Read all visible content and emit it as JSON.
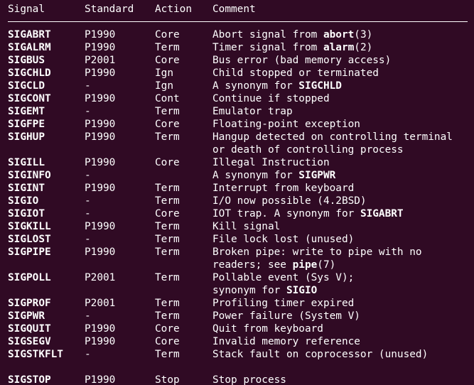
{
  "colors": {
    "background": "#300a24",
    "text": "#ffffff"
  },
  "header": {
    "signal": "Signal",
    "standard": "Standard",
    "action": "Action",
    "comment": "Comment"
  },
  "rows": [
    {
      "signal": "SIGABRT",
      "standard": "P1990",
      "action": "Core",
      "comment": [
        [
          "Abort signal from ",
          false
        ],
        [
          "abort",
          true
        ],
        [
          "(3)",
          false
        ]
      ]
    },
    {
      "signal": "SIGALRM",
      "standard": "P1990",
      "action": "Term",
      "comment": [
        [
          "Timer signal from ",
          false
        ],
        [
          "alarm",
          true
        ],
        [
          "(2)",
          false
        ]
      ]
    },
    {
      "signal": "SIGBUS",
      "standard": "P2001",
      "action": "Core",
      "comment": [
        [
          "Bus error (bad memory access)",
          false
        ]
      ]
    },
    {
      "signal": "SIGCHLD",
      "standard": "P1990",
      "action": "Ign",
      "comment": [
        [
          "Child stopped or terminated",
          false
        ]
      ]
    },
    {
      "signal": "SIGCLD",
      "standard": "-",
      "action": "Ign",
      "comment": [
        [
          "A synonym for ",
          false
        ],
        [
          "SIGCHLD",
          true
        ]
      ]
    },
    {
      "signal": "SIGCONT",
      "standard": "P1990",
      "action": "Cont",
      "comment": [
        [
          "Continue if stopped",
          false
        ]
      ]
    },
    {
      "signal": "SIGEMT",
      "standard": "-",
      "action": "Term",
      "comment": [
        [
          "Emulator trap",
          false
        ]
      ]
    },
    {
      "signal": "SIGFPE",
      "standard": "P1990",
      "action": "Core",
      "comment": [
        [
          "Floating-point exception",
          false
        ]
      ]
    },
    {
      "signal": "SIGHUP",
      "standard": "P1990",
      "action": "Term",
      "comment": [
        [
          "Hangup detected on controlling terminal",
          false
        ]
      ]
    },
    {
      "signal": "",
      "standard": "",
      "action": "",
      "comment": [
        [
          "or death of controlling process",
          false
        ]
      ]
    },
    {
      "signal": "SIGILL",
      "standard": "P1990",
      "action": "Core",
      "comment": [
        [
          "Illegal Instruction",
          false
        ]
      ]
    },
    {
      "signal": "SIGINFO",
      "standard": "-",
      "action": "",
      "comment": [
        [
          "A synonym for ",
          false
        ],
        [
          "SIGPWR",
          true
        ]
      ]
    },
    {
      "signal": "SIGINT",
      "standard": "P1990",
      "action": "Term",
      "comment": [
        [
          "Interrupt from keyboard",
          false
        ]
      ]
    },
    {
      "signal": "SIGIO",
      "standard": "-",
      "action": "Term",
      "comment": [
        [
          "I/O now possible (4.2BSD)",
          false
        ]
      ]
    },
    {
      "signal": "SIGIOT",
      "standard": "-",
      "action": "Core",
      "comment": [
        [
          "IOT trap. A synonym for ",
          false
        ],
        [
          "SIGABRT",
          true
        ]
      ]
    },
    {
      "signal": "SIGKILL",
      "standard": "P1990",
      "action": "Term",
      "comment": [
        [
          "Kill signal",
          false
        ]
      ]
    },
    {
      "signal": "SIGLOST",
      "standard": "-",
      "action": "Term",
      "comment": [
        [
          "File lock lost (unused)",
          false
        ]
      ]
    },
    {
      "signal": "SIGPIPE",
      "standard": "P1990",
      "action": "Term",
      "comment": [
        [
          "Broken pipe: write to pipe with no",
          false
        ]
      ]
    },
    {
      "signal": "",
      "standard": "",
      "action": "",
      "comment": [
        [
          "readers; see ",
          false
        ],
        [
          "pipe",
          true
        ],
        [
          "(7)",
          false
        ]
      ]
    },
    {
      "signal": "SIGPOLL",
      "standard": "P2001",
      "action": "Term",
      "comment": [
        [
          "Pollable event (Sys V);",
          false
        ]
      ]
    },
    {
      "signal": "",
      "standard": "",
      "action": "",
      "comment": [
        [
          "synonym for ",
          false
        ],
        [
          "SIGIO",
          true
        ]
      ]
    },
    {
      "signal": "SIGPROF",
      "standard": "P2001",
      "action": "Term",
      "comment": [
        [
          "Profiling timer expired",
          false
        ]
      ]
    },
    {
      "signal": "SIGPWR",
      "standard": "-",
      "action": "Term",
      "comment": [
        [
          "Power failure (System V)",
          false
        ]
      ]
    },
    {
      "signal": "SIGQUIT",
      "standard": "P1990",
      "action": "Core",
      "comment": [
        [
          "Quit from keyboard",
          false
        ]
      ]
    },
    {
      "signal": "SIGSEGV",
      "standard": "P1990",
      "action": "Core",
      "comment": [
        [
          "Invalid memory reference",
          false
        ]
      ]
    },
    {
      "signal": "SIGSTKFLT",
      "standard": "-",
      "action": "Term",
      "comment": [
        [
          "Stack fault on coprocessor (unused)",
          false
        ]
      ]
    },
    {
      "signal": "",
      "standard": "",
      "action": "",
      "comment": []
    },
    {
      "signal": "SIGSTOP",
      "standard": "P1990",
      "action": "Stop",
      "comment": [
        [
          "Stop process",
          false
        ]
      ]
    }
  ]
}
